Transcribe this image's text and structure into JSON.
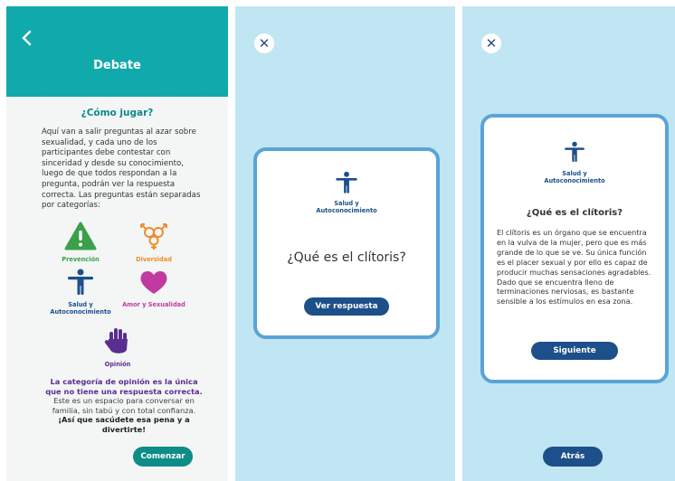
{
  "panel1": {
    "title": "Debate",
    "subtitle": "¿Cómo jugar?",
    "description": "Aquí van a salir preguntas al azar sobre sexualidad, y cada uno de los participantes debe contestar con sinceridad y desde su conocimiento, luego de que todos respondan a la pregunta, podrán ver la respuesta correcta. Las preguntas están separadas por categorías:",
    "categories": [
      {
        "label": "Prevención",
        "color": "#3aa14a",
        "icon": "warning-icon"
      },
      {
        "label": "Diversidad",
        "color": "#ee8c2c",
        "icon": "gender-symbols-icon"
      },
      {
        "label": "Salud y Autoconocimiento",
        "color": "#1d4f8a",
        "icon": "person-icon"
      },
      {
        "label": "Amor y Sexualidad",
        "color": "#c23a9f",
        "icon": "heart-icon"
      },
      {
        "label": "Opinión",
        "color": "#5a2e91",
        "icon": "hand-icon"
      }
    ],
    "info_highlight": "La categoría de opinión es la única que no tiene una respuesta correcta.",
    "info_body": "Este es un espacio para conversar en familia, sin tabú y con total confianza.",
    "info_close": "¡Así que sacúdete esa pena y a divertirte!",
    "start_button": "Comenzar"
  },
  "panel2": {
    "category": "Salud y Autoconocimiento",
    "question": "¿Qué es el clítoris?",
    "show_answer_button": "Ver respuesta"
  },
  "panel3": {
    "category": "Salud y Autoconocimiento",
    "question": "¿Qué es el clítoris?",
    "answer": "El clítoris es un órgano que se encuentra en la vulva de la mujer, pero que es más grande de lo que se ve. Su única función es el placer sexual y por ello es capaz de producir muchas sensaciones agradables. Dado que se encuentra lleno de terminaciones nerviosas, es bastante sensible a los estímulos en esa zona.",
    "next_button": "Siguiente",
    "back_button": "Atrás"
  },
  "colors": {
    "teal": "#10a9ac",
    "light_blue_bg": "#bfe6f2",
    "card_border": "#5aa4d6",
    "navy": "#1d4f8a"
  }
}
